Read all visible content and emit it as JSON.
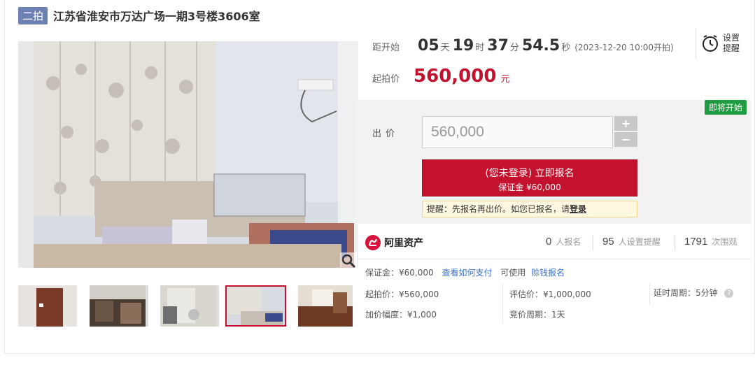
{
  "header": {
    "round_badge": "二拍",
    "title": "江苏省淮安市万达广场一期3号楼3606室"
  },
  "countdown": {
    "label": "距开始",
    "days": "05",
    "days_unit": "天",
    "hours": "19",
    "hours_unit": "时",
    "minutes": "37",
    "minutes_unit": "分",
    "seconds": "54.5",
    "seconds_unit": "秒",
    "start_note": "(2023-12-20 10:00开拍)"
  },
  "reminder": {
    "line1": "设置",
    "line2": "提醒",
    "icon": "alarm-clock-icon"
  },
  "start_price": {
    "label": "起拍价",
    "value": "560,000",
    "unit": "元"
  },
  "bid": {
    "status_badge": "即将开始",
    "label": "出价",
    "input_value": "560,000",
    "plus": "+",
    "minus": "−",
    "signup_main": "(您未登录) 立即报名",
    "signup_sub": "保证金 ¥60,000",
    "notice_text": "提醒：先报名再出价。如您已报名，请",
    "notice_link": "登录"
  },
  "stats": {
    "brand": "阿里资产",
    "signups_num": "0",
    "signups_label": "人报名",
    "reminders_num": "95",
    "reminders_label": "人设置提醒",
    "views_num": "1791",
    "views_label": "次围观"
  },
  "details": {
    "deposit": "保证金：¥60,000",
    "how_to_pay": "查看如何支付",
    "usable": "可使用",
    "credit_signup": "赊钱报名",
    "start_price": "起拍价：¥560,000",
    "appraisal": "评估价：¥1,000,000",
    "delay": "延时周期：5分钟",
    "increment": "加价幅度：¥1,000",
    "cycle": "竞价周期：1天"
  },
  "colors": {
    "accent_red": "#c4112d",
    "badge_blue": "#6d80b3",
    "badge_green": "#1e9c3f",
    "link_blue": "#3b73c4"
  }
}
